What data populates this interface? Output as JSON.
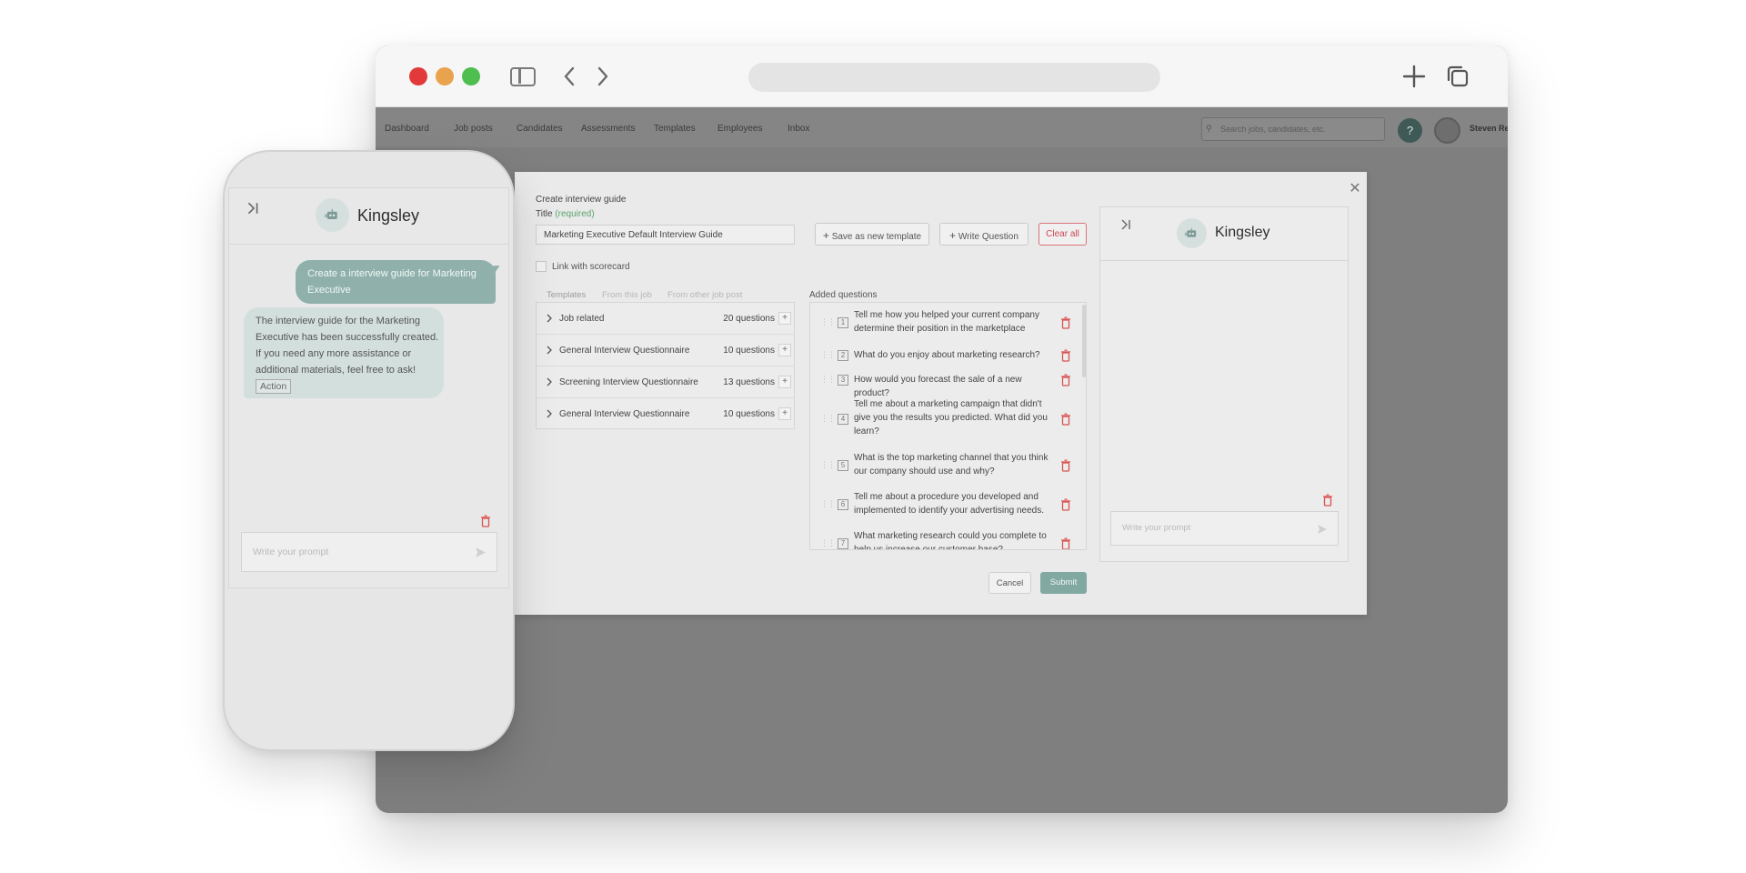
{
  "app": {
    "nav_items": [
      "Dashboard",
      "Job posts",
      "Candidates",
      "Assessments",
      "Templates",
      "Employees",
      "Inbox"
    ],
    "search_placeholder": "Search jobs, candidates, etc.",
    "help_label": "?",
    "user_name": "Steven Re"
  },
  "modal": {
    "heading": "Create interview guide",
    "title_label": "Title",
    "title_required": "(required)",
    "title_value": "Marketing Executive Default Interview Guide",
    "save_template_label": "Save as new template",
    "write_question_label": "Write Question",
    "clear_all_label": "Clear all",
    "link_scorecard_label": "Link with scorecard",
    "tabs": [
      "Templates",
      "From this job",
      "From other job post"
    ],
    "templates": [
      {
        "name": "Job related",
        "count": "20 questions"
      },
      {
        "name": "General Interview Questionnaire",
        "count": "10 questions"
      },
      {
        "name": "Screening Interview Questionnaire",
        "count": "13 questions"
      },
      {
        "name": "General Interview Questionnaire",
        "count": "10 questions"
      }
    ],
    "added_label": "Added questions",
    "questions": [
      {
        "num": "1",
        "text": "Tell me how you helped your current company determine their position in the marketplace"
      },
      {
        "num": "2",
        "text": "What do you enjoy about marketing research?"
      },
      {
        "num": "3",
        "text": "How would you forecast the sale of a new product?"
      },
      {
        "num": "4",
        "text": "Tell me about a marketing campaign that didn't give you the results you predicted. What did you learn?"
      },
      {
        "num": "5",
        "text": "What is the top marketing channel that you think our company should use and why?"
      },
      {
        "num": "6",
        "text": "Tell me about a procedure you developed and implemented to identify your advertising needs."
      },
      {
        "num": "7",
        "text": "What marketing research could you complete to help us increase our customer base?"
      }
    ],
    "cancel_label": "Cancel",
    "submit_label": "Submit"
  },
  "chat": {
    "bot_name": "Kingsley",
    "prompt_placeholder": "Write your prompt",
    "user_message": "Create a interview guide for Marketing Executive",
    "bot_message": "The interview guide for the Marketing Executive has been successfully created. If you need any more assistance or additional materials, feel free to ask!",
    "action_label": "Action"
  },
  "colors": {
    "accent": "#82a8a2",
    "danger": "#d9534f",
    "required": "#5aa36d"
  }
}
